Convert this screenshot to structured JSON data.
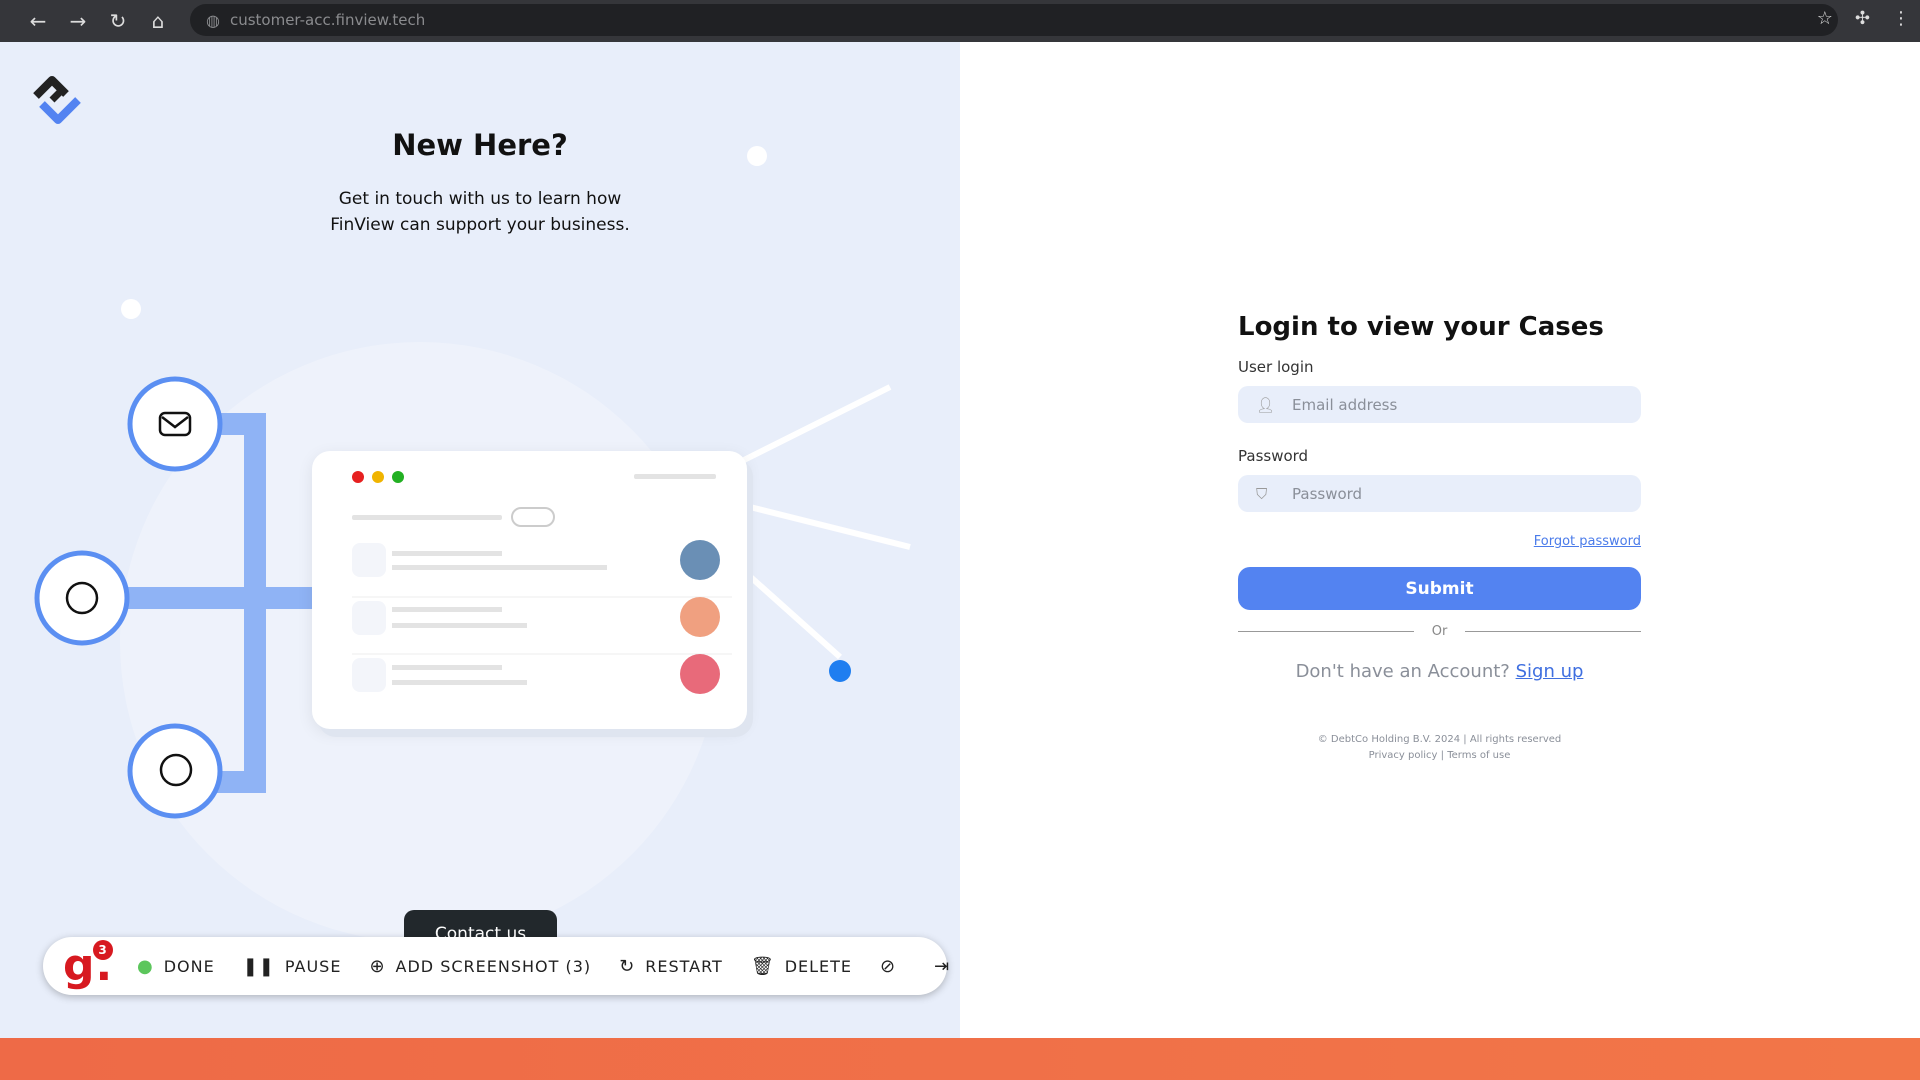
{
  "browser": {
    "url": "customer-acc.finview.tech",
    "back": "←",
    "forward": "→",
    "reload": "↻",
    "home": "⌂"
  },
  "promo": {
    "title": "New Here?",
    "line1": "Get in touch with us to learn how",
    "line2": "FinView can support your business.",
    "contact_label": "Contact us"
  },
  "login": {
    "title": "Login to view your Cases",
    "user_label": "User login",
    "email_placeholder": "Email address",
    "password_label": "Password",
    "password_placeholder": "Password",
    "forgot": "Forgot password",
    "submit": "Submit",
    "or": "Or",
    "no_account": "Don't have an Account?",
    "signup": "Sign up",
    "copyright": "© DebtCo Holding B.V. 2024 | All rights reserved",
    "privacy": "Privacy policy",
    "sep": "|",
    "terms": "Terms of use"
  },
  "toolbar": {
    "badge": "3",
    "done": "DONE",
    "pause": "PAUSE",
    "add_screenshot": "ADD SCREENSHOT (3)",
    "restart": "RESTART",
    "delete": "DELETE"
  },
  "colors": {
    "accent": "#5383f1",
    "left_bg": "#e8eefa",
    "bottom_bar": "#ee6a47"
  }
}
